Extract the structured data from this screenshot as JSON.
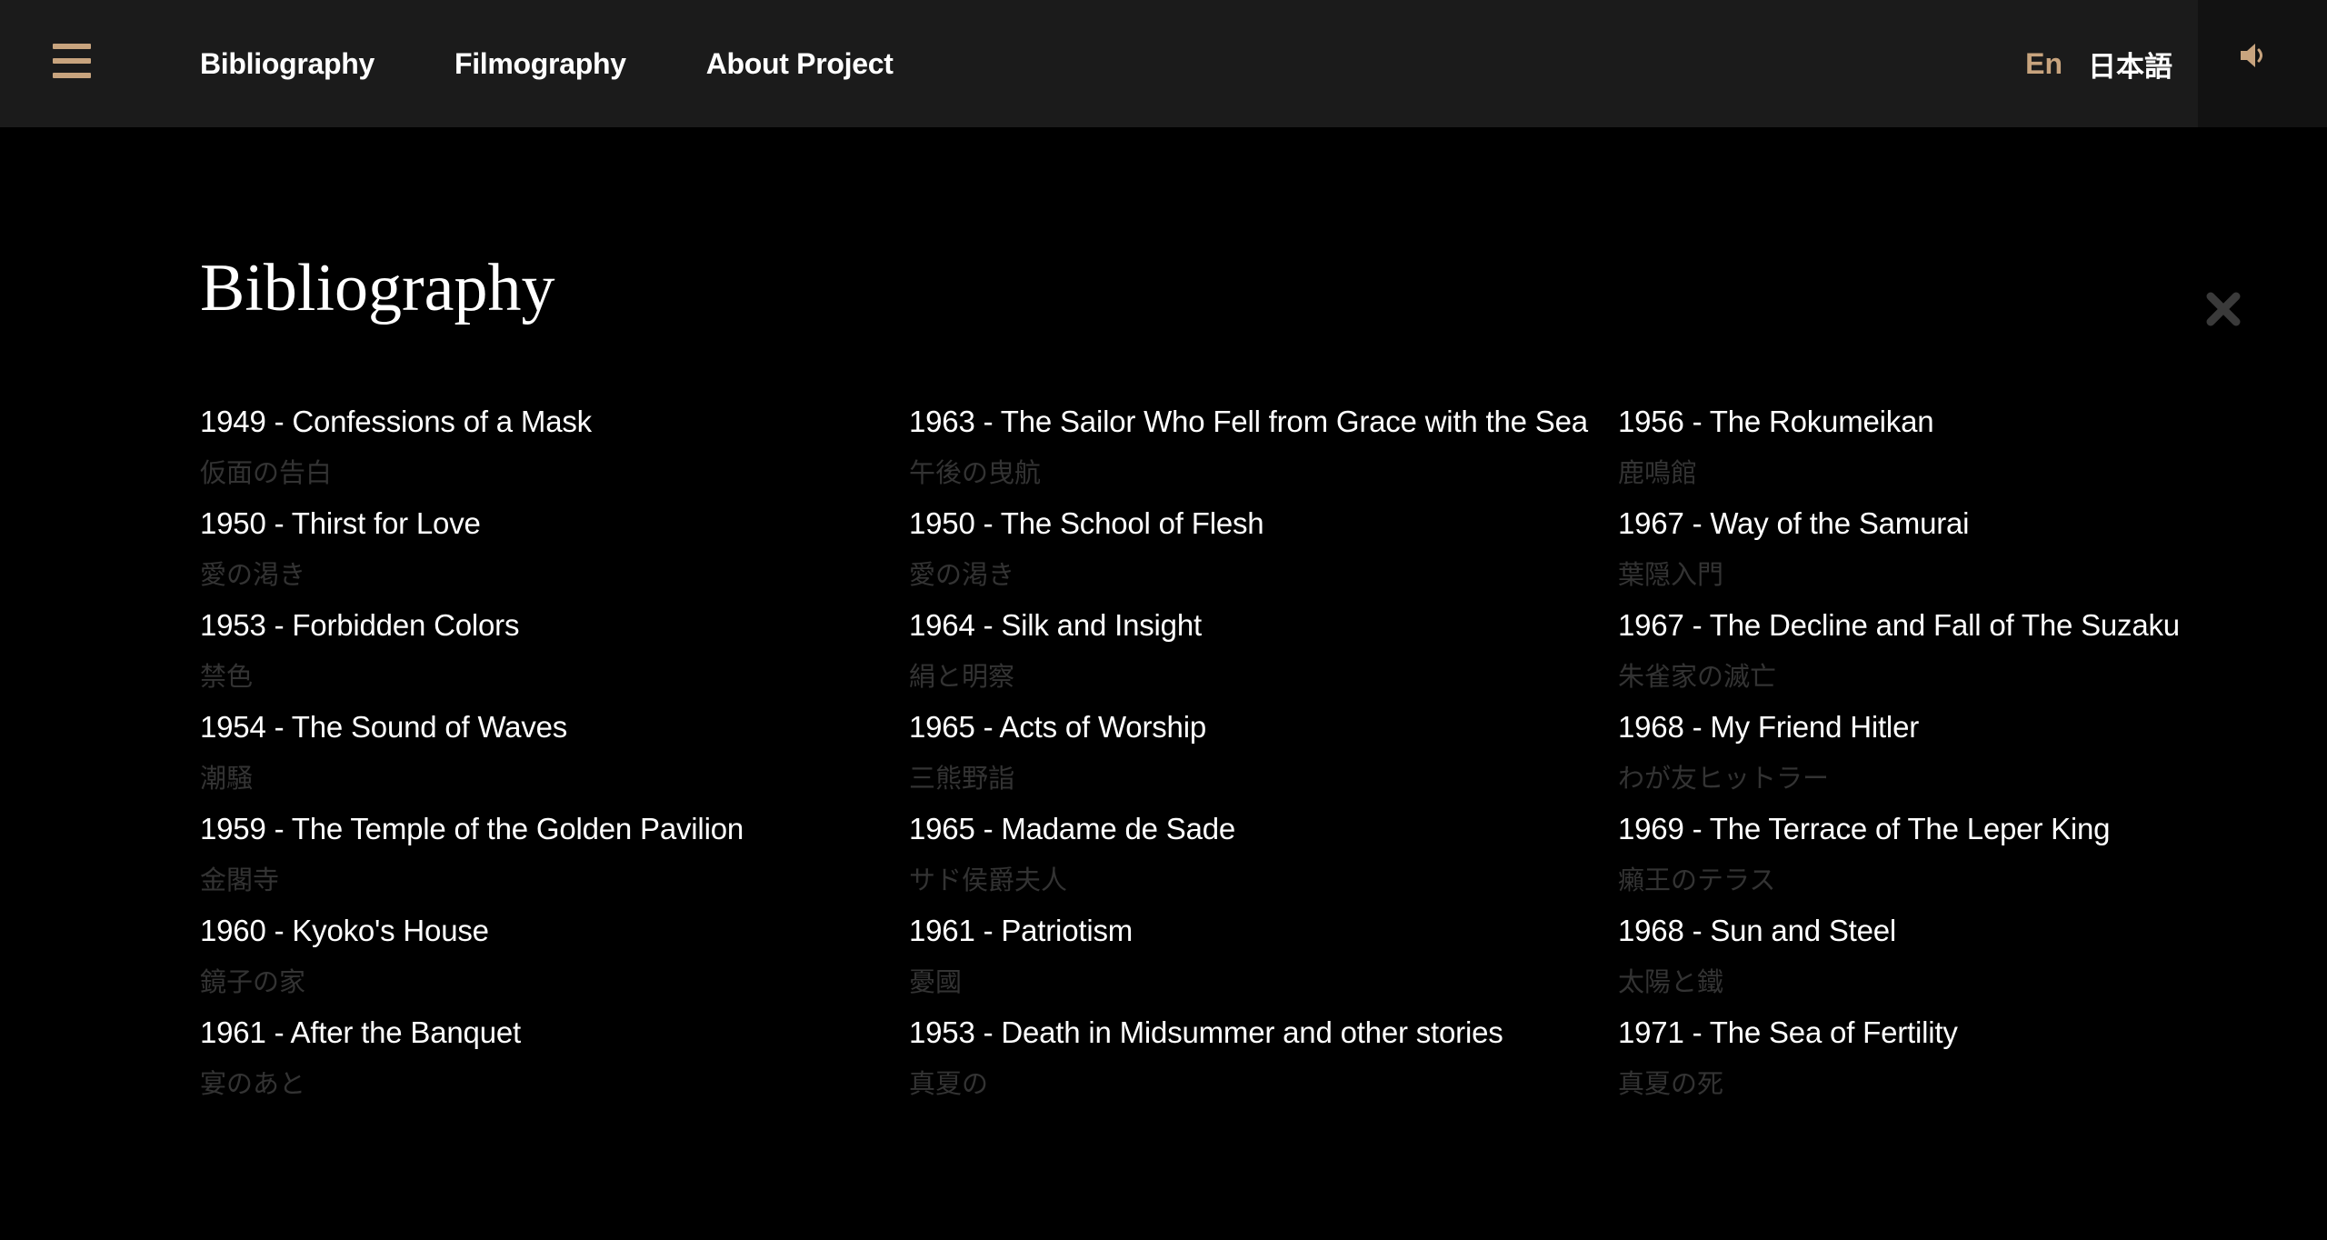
{
  "header": {
    "nav": [
      "Bibliography",
      "Filmography",
      "About Project"
    ],
    "lang_en": "En",
    "lang_ja": "日本語",
    "accent_color": "#c8a47e"
  },
  "icons": {
    "menu": "hamburger-menu-icon",
    "sound": "speaker-icon",
    "close": "close-x-icon"
  },
  "page": {
    "title": "Bibliography"
  },
  "columns": [
    [
      {
        "en": "1949 - Confessions of a Mask",
        "ja": "仮面の告白"
      },
      {
        "en": "1950 - Thirst for Love",
        "ja": "愛の渇き"
      },
      {
        "en": "1953 - Forbidden Colors",
        "ja": "禁色"
      },
      {
        "en": "1954 - The Sound of Waves",
        "ja": "潮騒"
      },
      {
        "en": "1959 - The Temple of the Golden Pavilion",
        "ja": "金閣寺"
      },
      {
        "en": "1960 - Kyoko's House",
        "ja": "鏡子の家"
      },
      {
        "en": "1961 - After the Banquet",
        "ja": "宴のあと"
      }
    ],
    [
      {
        "en": "1963 - The Sailor Who Fell from Grace with the Sea",
        "ja": "午後の曳航"
      },
      {
        "en": "1950 - The School of Flesh",
        "ja": "愛の渇き"
      },
      {
        "en": "1964 - Silk and Insight",
        "ja": "絹と明察"
      },
      {
        "en": "1965 - Acts of Worship",
        "ja": "三熊野詣"
      },
      {
        "en": "1965 - Madame de Sade",
        "ja": "サド侯爵夫人"
      },
      {
        "en": "1961 - Patriotism",
        "ja": "憂國"
      },
      {
        "en": "1953 - Death in Midsummer and other stories",
        "ja": "真夏の"
      }
    ],
    [
      {
        "en": "1956 - The Rokumeikan",
        "ja": "鹿鳴館"
      },
      {
        "en": "1967 - Way of the Samurai",
        "ja": "葉隠入門"
      },
      {
        "en": "1967 - The Decline and Fall of The Suzaku",
        "ja": "朱雀家の滅亡"
      },
      {
        "en": "1968 - My Friend Hitler",
        "ja": "わが友ヒットラー"
      },
      {
        "en": "1969 - The Terrace of The Leper King",
        "ja": "癩王のテラス"
      },
      {
        "en": "1968 - Sun and Steel",
        "ja": "太陽と鐵"
      },
      {
        "en": "1971 - The Sea of Fertility",
        "ja": "真夏の死"
      }
    ]
  ]
}
